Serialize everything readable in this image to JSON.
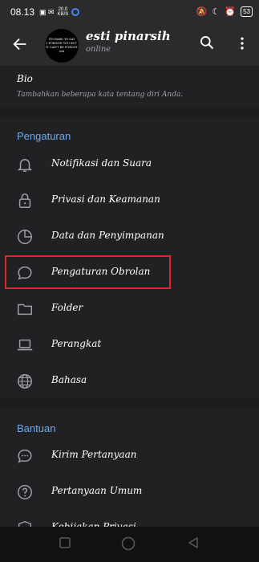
{
  "status": {
    "time": "08.13",
    "net_top": "20,0",
    "net_bottom": "KB/S",
    "battery": "53"
  },
  "header": {
    "name": "esti pinarsih",
    "status": "online",
    "avatar_line1": "ITS HARD TO SAY",
    "avatar_line2": "I FORGIVE YOU BUT IT CAN'T BE FORGOT",
    "avatar_line3": "esti"
  },
  "bio": {
    "title": "Bio",
    "description": "Tambahkan beberapa kata tentang diri Anda."
  },
  "settings": {
    "heading": "Pengaturan",
    "items": [
      {
        "label": "Notifikasi dan Suara",
        "icon": "bell-icon"
      },
      {
        "label": "Privasi dan Keamanan",
        "icon": "lock-icon"
      },
      {
        "label": "Data dan Penyimpanan",
        "icon": "clock-pie-icon"
      },
      {
        "label": "Pengaturan Obrolan",
        "icon": "chat-bubble-icon"
      },
      {
        "label": "Folder",
        "icon": "folder-icon"
      },
      {
        "label": "Perangkat",
        "icon": "laptop-icon"
      },
      {
        "label": "Bahasa",
        "icon": "globe-icon"
      }
    ]
  },
  "help": {
    "heading": "Bantuan",
    "items": [
      {
        "label": "Kirim Pertanyaan",
        "icon": "chat-dots-icon"
      },
      {
        "label": "Pertanyaan Umum",
        "icon": "question-icon"
      },
      {
        "label": "Kebijakan Privasi",
        "icon": "shield-icon"
      }
    ]
  },
  "colors": {
    "accent": "#6ea9e8",
    "highlight": "#e0262b"
  }
}
